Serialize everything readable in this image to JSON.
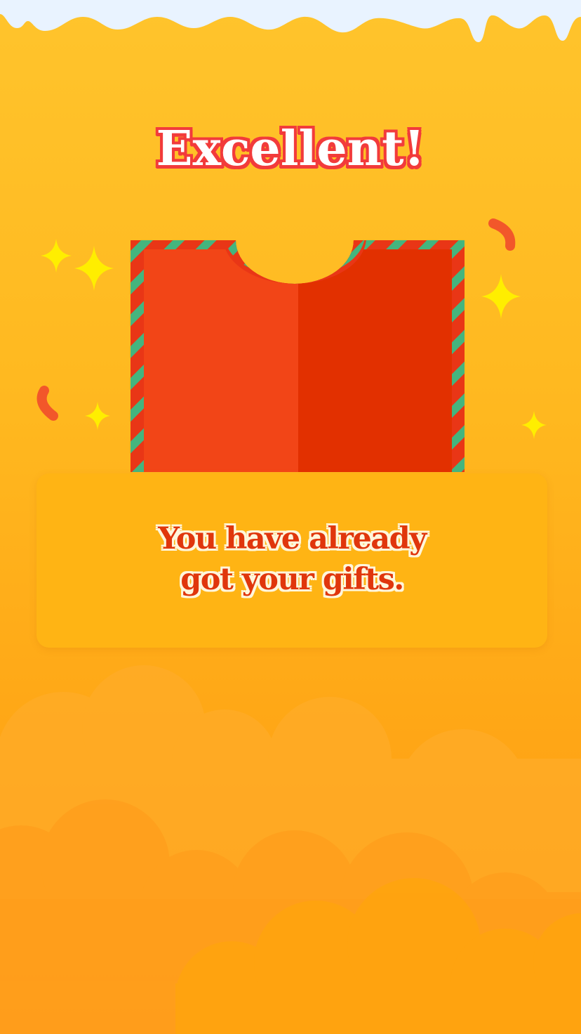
{
  "title": {
    "text": "Excellent",
    "exclamation": "!"
  },
  "message": {
    "line1": "You have already",
    "line2": "got your gifts."
  },
  "icons": {
    "envelope": "red-envelope-icon",
    "sparkle": "sparkle-icon",
    "confetti": "confetti-icon",
    "snow": "snow-drip-icon",
    "clouds": "cloud-icon"
  },
  "colors": {
    "background_top": "#ffc42c",
    "background_bottom": "#ff9510",
    "title_outline": "#f23b3b",
    "envelope_left": "#f24517",
    "envelope_right": "#e23000",
    "stripe_green": "#44b57e",
    "panel": "#ffb414",
    "message_text": "#e0360c",
    "sparkle": "#ffee00"
  }
}
